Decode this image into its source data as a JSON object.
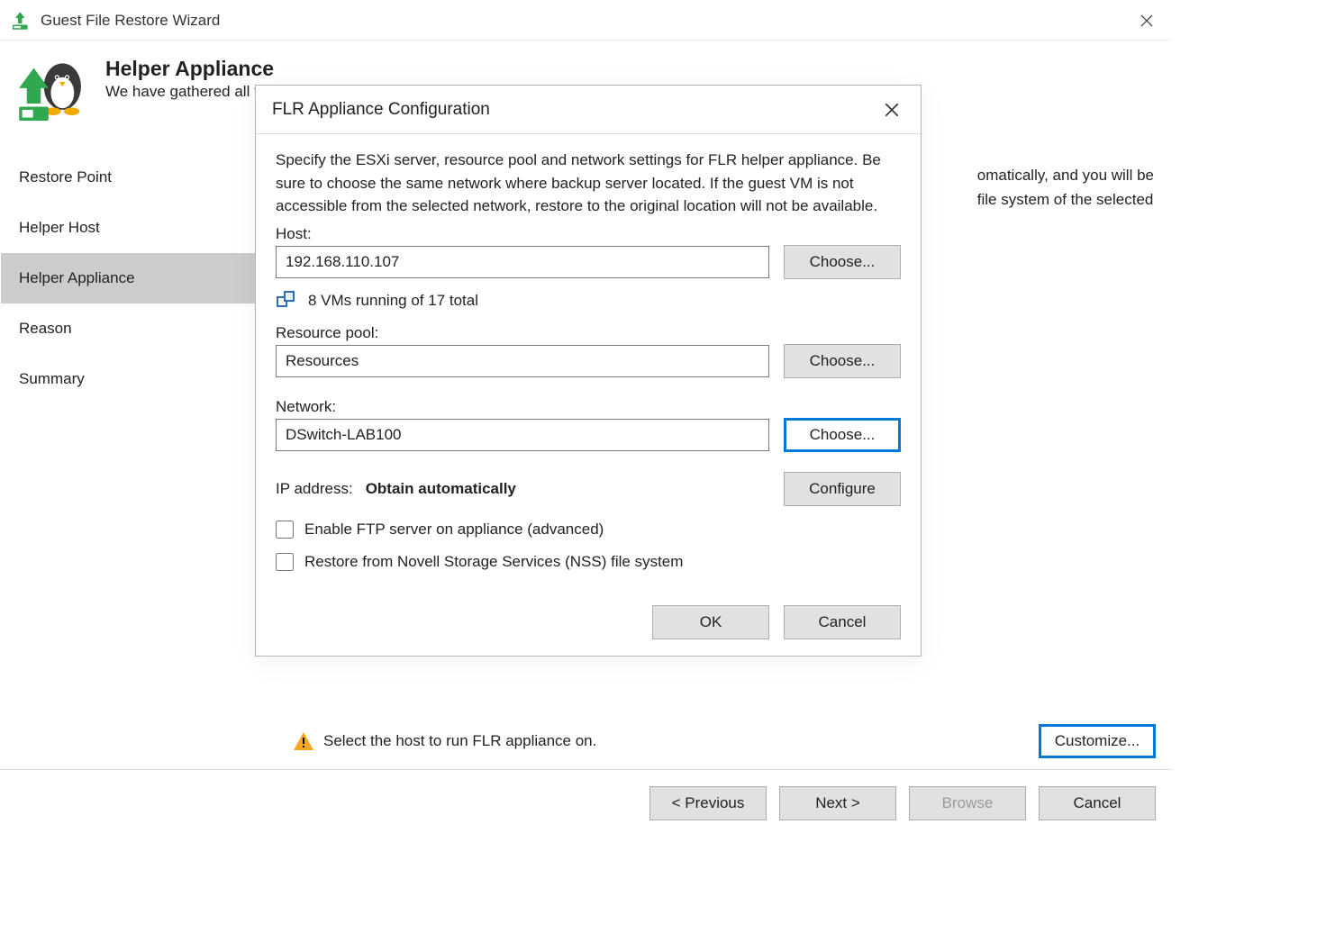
{
  "wizard": {
    "title": "Guest File Restore Wizard",
    "header_title": "Helper Appliance",
    "header_subtitle": "We have gathered all the required information to start the helper appliance.",
    "content_text": "omatically, and you will be\nfile system of the selected",
    "status_text": "Select the host to run FLR appliance on.",
    "customize_label": "Customize...",
    "footer": {
      "previous": "< Previous",
      "next": "Next >",
      "browse": "Browse",
      "cancel": "Cancel"
    },
    "side": [
      "Restore Point",
      "Helper Host",
      "Helper Appliance",
      "Reason",
      "Summary"
    ],
    "side_selected_index": 2
  },
  "modal": {
    "title": "FLR Appliance Configuration",
    "desc": "Specify the ESXi server, resource pool and network settings for FLR helper appliance. Be sure to choose the same network where backup server located. If the guest VM is not accessible from the selected network, restore to the original location will not be available.",
    "host_label": "Host:",
    "host_value": "192.168.110.107",
    "host_choose": "Choose...",
    "host_status": "8 VMs running of 17 total",
    "pool_label": "Resource pool:",
    "pool_value": "Resources",
    "pool_choose": "Choose...",
    "network_label": "Network:",
    "network_value": "DSwitch-LAB100",
    "network_choose": "Choose...",
    "ip_key": "IP address:",
    "ip_value": "Obtain automatically",
    "configure": "Configure",
    "check_ftp": "Enable FTP server on appliance (advanced)",
    "check_nss": "Restore from Novell Storage Services (NSS) file system",
    "ok": "OK",
    "cancel": "Cancel"
  }
}
